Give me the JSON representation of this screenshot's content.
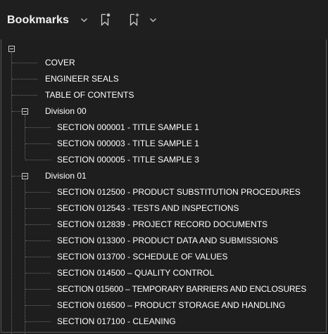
{
  "panel": {
    "title": "Bookmarks"
  },
  "icons": {
    "title_chevron": "chevron-down-icon",
    "new_bookmark_from_structure": "bookmark-sparkle-icon",
    "add_bookmark": "bookmark-add-icon",
    "add_chevron": "chevron-down-icon",
    "collapse": "collapse-minus-icon"
  },
  "colors": {
    "background": "#1e1e1e",
    "text": "#ffffff",
    "tree_lines": "#6b6b6b",
    "icons": "#c8c8c8"
  },
  "tree": {
    "top_items": [
      {
        "label": "COVER"
      },
      {
        "label": "ENGINEER SEALS"
      },
      {
        "label": "TABLE OF CONTENTS"
      }
    ],
    "divisions": [
      {
        "label": "Division 00",
        "expanded": true,
        "children": [
          {
            "label": "SECTION 000001 - TITLE SAMPLE 1"
          },
          {
            "label": "SECTION 000003 - TITLE SAMPLE 1"
          },
          {
            "label": "SECTION 000005 - TITLE SAMPLE 3"
          }
        ]
      },
      {
        "label": "Division 01",
        "expanded": true,
        "children": [
          {
            "label": "SECTION 012500 - PRODUCT SUBSTITUTION PROCEDURES"
          },
          {
            "label": "SECTION 012543 - TESTS AND INSPECTIONS"
          },
          {
            "label": "SECTION 012839 - PROJECT RECORD DOCUMENTS"
          },
          {
            "label": "SECTION 013300 - PRODUCT DATA AND SUBMISSIONS"
          },
          {
            "label": "SECTION 013700 - SCHEDULE OF VALUES"
          },
          {
            "label": "SECTION 014500 – QUALITY CONTROL"
          },
          {
            "label": "SECTION 015600 – TEMPORARY BARRIERS AND ENCLOSURES"
          },
          {
            "label": "SECTION 016500 – PRODUCT STORAGE AND HANDLING"
          },
          {
            "label": "SECTION 017100 - CLEANING"
          }
        ]
      }
    ]
  }
}
